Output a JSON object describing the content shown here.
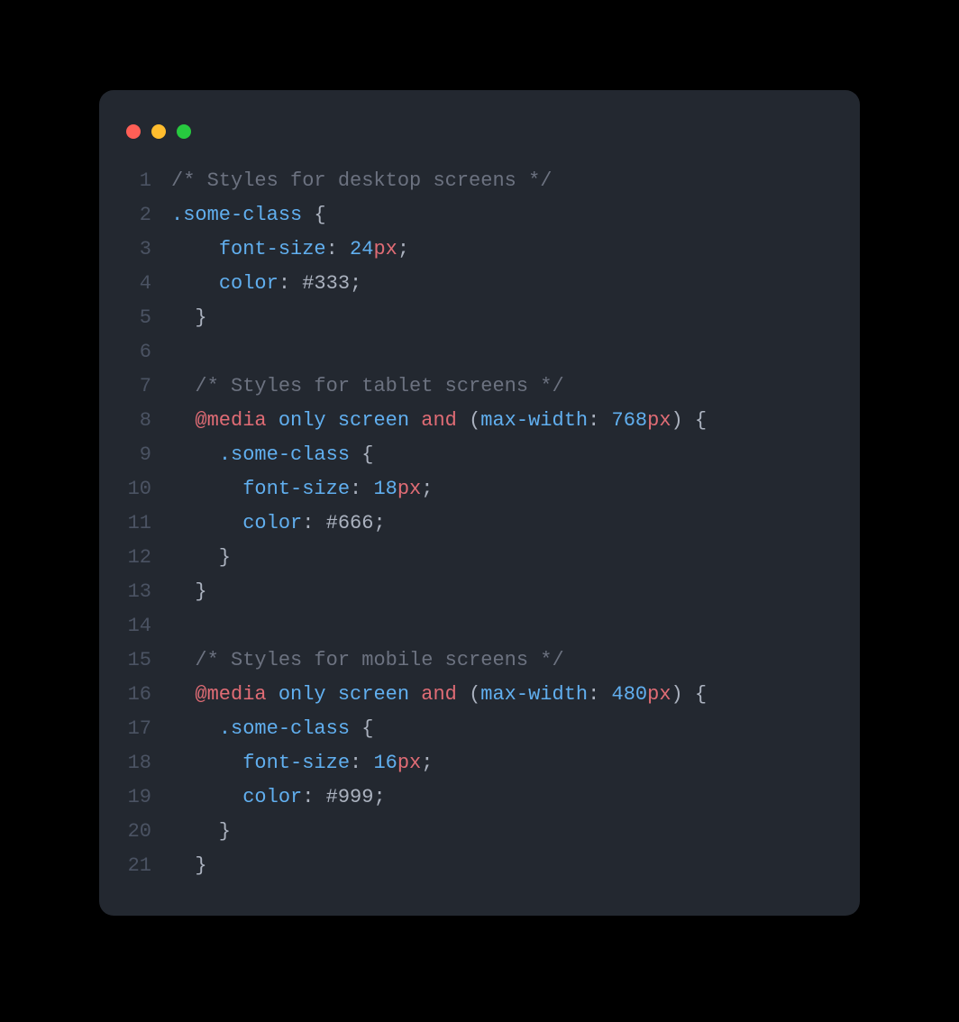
{
  "window": {
    "dots": [
      "red",
      "yellow",
      "green"
    ]
  },
  "code": {
    "lines": [
      {
        "n": "1",
        "tokens": [
          {
            "cls": "tok-comment",
            "t": "/* Styles for desktop screens */"
          }
        ]
      },
      {
        "n": "2",
        "tokens": [
          {
            "cls": "tok-selector",
            "t": ".some-class"
          },
          {
            "cls": "tok-punct",
            "t": " {"
          }
        ]
      },
      {
        "n": "3",
        "tokens": [
          {
            "cls": "tok-punct",
            "t": "    "
          },
          {
            "cls": "tok-prop",
            "t": "font-size"
          },
          {
            "cls": "tok-punct",
            "t": ": "
          },
          {
            "cls": "tok-num",
            "t": "24"
          },
          {
            "cls": "tok-unit",
            "t": "px"
          },
          {
            "cls": "tok-punct",
            "t": ";"
          }
        ]
      },
      {
        "n": "4",
        "tokens": [
          {
            "cls": "tok-punct",
            "t": "    "
          },
          {
            "cls": "tok-prop",
            "t": "color"
          },
          {
            "cls": "tok-punct",
            "t": ": #333;"
          }
        ]
      },
      {
        "n": "5",
        "tokens": [
          {
            "cls": "tok-punct",
            "t": "  }"
          }
        ]
      },
      {
        "n": "6",
        "tokens": [
          {
            "cls": "tok-punct",
            "t": ""
          }
        ]
      },
      {
        "n": "7",
        "tokens": [
          {
            "cls": "tok-punct",
            "t": "  "
          },
          {
            "cls": "tok-comment",
            "t": "/* Styles for tablet screens */"
          }
        ]
      },
      {
        "n": "8",
        "tokens": [
          {
            "cls": "tok-punct",
            "t": "  "
          },
          {
            "cls": "tok-at",
            "t": "@media"
          },
          {
            "cls": "tok-punct",
            "t": " "
          },
          {
            "cls": "tok-kw",
            "t": "only"
          },
          {
            "cls": "tok-punct",
            "t": " "
          },
          {
            "cls": "tok-kw",
            "t": "screen"
          },
          {
            "cls": "tok-punct",
            "t": " "
          },
          {
            "cls": "tok-and",
            "t": "and"
          },
          {
            "cls": "tok-punct",
            "t": " ("
          },
          {
            "cls": "tok-prop",
            "t": "max-width"
          },
          {
            "cls": "tok-punct",
            "t": ": "
          },
          {
            "cls": "tok-num",
            "t": "768"
          },
          {
            "cls": "tok-unit",
            "t": "px"
          },
          {
            "cls": "tok-punct",
            "t": ") {"
          }
        ]
      },
      {
        "n": "9",
        "tokens": [
          {
            "cls": "tok-punct",
            "t": "    "
          },
          {
            "cls": "tok-selector",
            "t": ".some-class"
          },
          {
            "cls": "tok-punct",
            "t": " {"
          }
        ]
      },
      {
        "n": "10",
        "tokens": [
          {
            "cls": "tok-punct",
            "t": "      "
          },
          {
            "cls": "tok-prop",
            "t": "font-size"
          },
          {
            "cls": "tok-punct",
            "t": ": "
          },
          {
            "cls": "tok-num",
            "t": "18"
          },
          {
            "cls": "tok-unit",
            "t": "px"
          },
          {
            "cls": "tok-punct",
            "t": ";"
          }
        ]
      },
      {
        "n": "11",
        "tokens": [
          {
            "cls": "tok-punct",
            "t": "      "
          },
          {
            "cls": "tok-prop",
            "t": "color"
          },
          {
            "cls": "tok-punct",
            "t": ": #666;"
          }
        ]
      },
      {
        "n": "12",
        "tokens": [
          {
            "cls": "tok-punct",
            "t": "    }"
          }
        ]
      },
      {
        "n": "13",
        "tokens": [
          {
            "cls": "tok-punct",
            "t": "  }"
          }
        ]
      },
      {
        "n": "14",
        "tokens": [
          {
            "cls": "tok-punct",
            "t": ""
          }
        ]
      },
      {
        "n": "15",
        "tokens": [
          {
            "cls": "tok-punct",
            "t": "  "
          },
          {
            "cls": "tok-comment",
            "t": "/* Styles for mobile screens */"
          }
        ]
      },
      {
        "n": "16",
        "tokens": [
          {
            "cls": "tok-punct",
            "t": "  "
          },
          {
            "cls": "tok-at",
            "t": "@media"
          },
          {
            "cls": "tok-punct",
            "t": " "
          },
          {
            "cls": "tok-kw",
            "t": "only"
          },
          {
            "cls": "tok-punct",
            "t": " "
          },
          {
            "cls": "tok-kw",
            "t": "screen"
          },
          {
            "cls": "tok-punct",
            "t": " "
          },
          {
            "cls": "tok-and",
            "t": "and"
          },
          {
            "cls": "tok-punct",
            "t": " ("
          },
          {
            "cls": "tok-prop",
            "t": "max-width"
          },
          {
            "cls": "tok-punct",
            "t": ": "
          },
          {
            "cls": "tok-num",
            "t": "480"
          },
          {
            "cls": "tok-unit",
            "t": "px"
          },
          {
            "cls": "tok-punct",
            "t": ") {"
          }
        ]
      },
      {
        "n": "17",
        "tokens": [
          {
            "cls": "tok-punct",
            "t": "    "
          },
          {
            "cls": "tok-selector",
            "t": ".some-class"
          },
          {
            "cls": "tok-punct",
            "t": " {"
          }
        ]
      },
      {
        "n": "18",
        "tokens": [
          {
            "cls": "tok-punct",
            "t": "      "
          },
          {
            "cls": "tok-prop",
            "t": "font-size"
          },
          {
            "cls": "tok-punct",
            "t": ": "
          },
          {
            "cls": "tok-num",
            "t": "16"
          },
          {
            "cls": "tok-unit",
            "t": "px"
          },
          {
            "cls": "tok-punct",
            "t": ";"
          }
        ]
      },
      {
        "n": "19",
        "tokens": [
          {
            "cls": "tok-punct",
            "t": "      "
          },
          {
            "cls": "tok-prop",
            "t": "color"
          },
          {
            "cls": "tok-punct",
            "t": ": #999;"
          }
        ]
      },
      {
        "n": "20",
        "tokens": [
          {
            "cls": "tok-punct",
            "t": "    }"
          }
        ]
      },
      {
        "n": "21",
        "tokens": [
          {
            "cls": "tok-punct",
            "t": "  }"
          }
        ]
      }
    ]
  }
}
